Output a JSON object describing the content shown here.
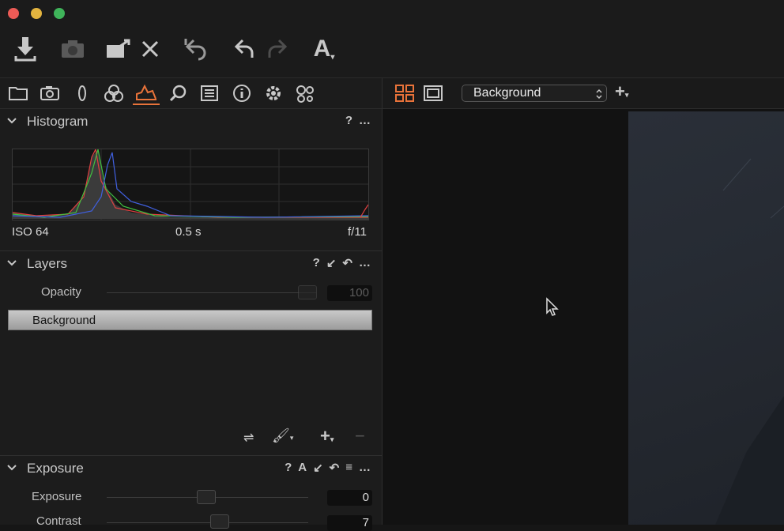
{
  "toolbar": {
    "buttons": [
      {
        "name": "import-icon"
      },
      {
        "name": "camera-icon"
      },
      {
        "name": "export-icon"
      },
      {
        "name": "delete-icon"
      },
      {
        "name": "reset-icon"
      },
      {
        "name": "undo-icon"
      },
      {
        "name": "redo-icon"
      },
      {
        "name": "text-tool-icon",
        "label": "A"
      }
    ]
  },
  "tool_tabs": [
    "folder-icon",
    "camera-icon",
    "lens-icon",
    "color-icon",
    "exposure-icon",
    "search-icon",
    "details-icon",
    "info-icon",
    "settings-icon",
    "batch-icon"
  ],
  "histogram": {
    "title": "Histogram",
    "help": "?",
    "more": "…",
    "iso": "ISO 64",
    "shutter": "0.5 s",
    "aperture": "f/11"
  },
  "layers": {
    "title": "Layers",
    "help": "?",
    "more": "…",
    "opacity_label": "Opacity",
    "opacity_value": "100",
    "layer_name": "Background",
    "add": "+",
    "remove": "−"
  },
  "exposure": {
    "title": "Exposure",
    "help": "?",
    "auto": "A",
    "more": "…",
    "rows": [
      {
        "label": "Exposure",
        "value": "0"
      },
      {
        "label": "Contrast",
        "value": "7"
      }
    ]
  },
  "viewer": {
    "variant_select": "Background",
    "add": "+"
  },
  "colors": {
    "accent": "#e9733a"
  }
}
